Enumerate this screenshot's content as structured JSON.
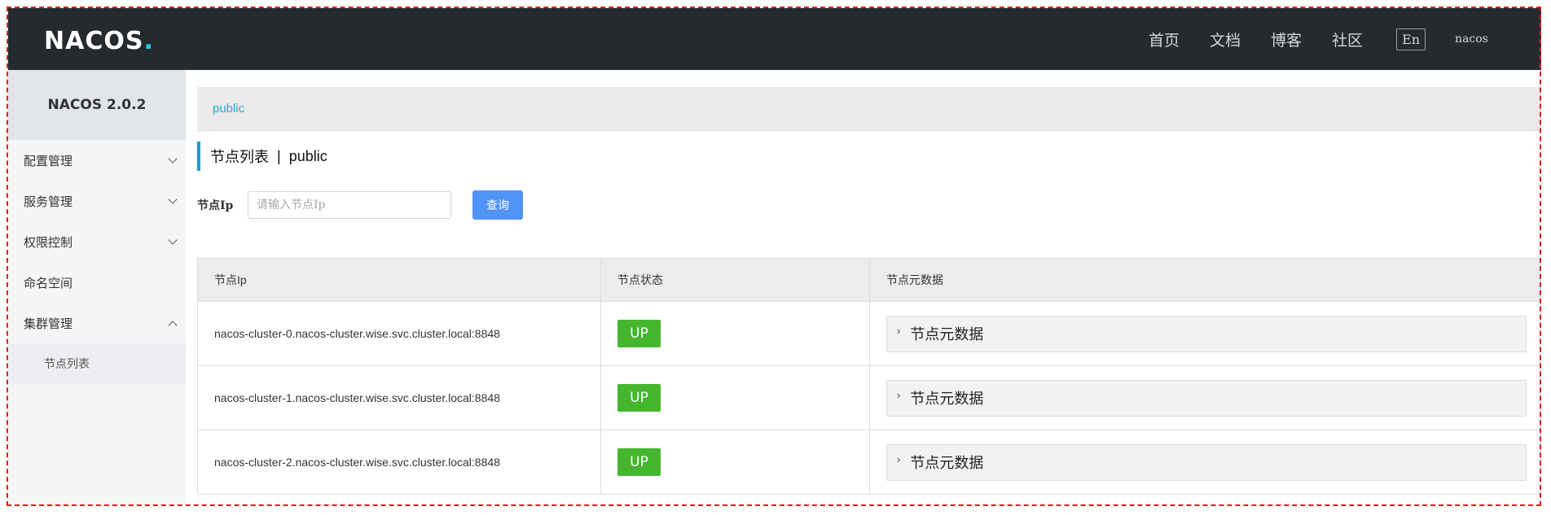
{
  "header": {
    "logo_text": "NACOS",
    "logo_dot": ".",
    "nav": [
      "首页",
      "文档",
      "博客",
      "社区"
    ],
    "lang_button": "En",
    "user": "nacos"
  },
  "sidebar": {
    "version": "NACOS 2.0.2",
    "items": [
      {
        "label": "配置管理"
      },
      {
        "label": "服务管理"
      },
      {
        "label": "权限控制"
      },
      {
        "label": "命名空间"
      },
      {
        "label": "集群管理"
      }
    ],
    "sub_items": [
      {
        "label": "节点列表"
      }
    ]
  },
  "main": {
    "breadcrumb": "public",
    "title": "节点列表",
    "title_sep": "|",
    "title_namespace": "public",
    "filter": {
      "label": "节点Ip",
      "placeholder": "请输入节点Ip",
      "button": "查询"
    },
    "table": {
      "headers": [
        "节点Ip",
        "节点状态",
        "节点元数据"
      ],
      "rows": [
        {
          "ip": "nacos-cluster-0.nacos-cluster.wise.svc.cluster.local:8848",
          "status": "UP",
          "meta": "节点元数据"
        },
        {
          "ip": "nacos-cluster-1.nacos-cluster.wise.svc.cluster.local:8848",
          "status": "UP",
          "meta": "节点元数据"
        },
        {
          "ip": "nacos-cluster-2.nacos-cluster.wise.svc.cluster.local:8848",
          "status": "UP",
          "meta": "节点元数据"
        }
      ]
    }
  },
  "icons": {
    "expand": "chevron-down-icon",
    "collapse": "chevron-up-icon",
    "row_expand": "chevron-right-icon"
  },
  "colors": {
    "header_bg": "#252a2f",
    "accent": "#1ab0d2",
    "primary_button": "#5194f7",
    "status_up": "#45b72e"
  }
}
